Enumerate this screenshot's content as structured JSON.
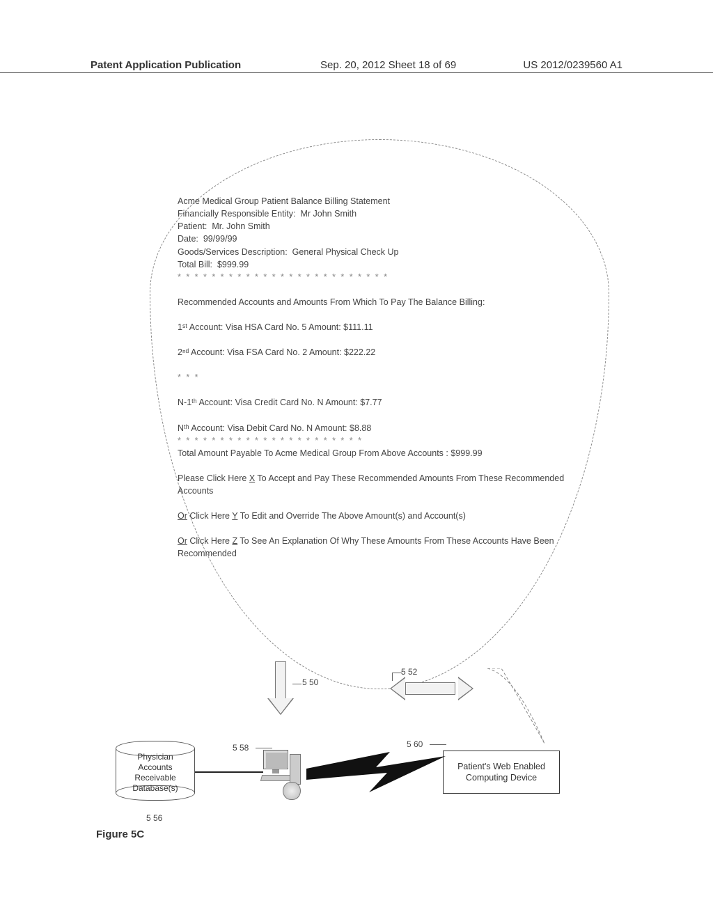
{
  "header": {
    "left": "Patent Application Publication",
    "center": "Sep. 20, 2012  Sheet 18 of 69",
    "right": "US 2012/0239560 A1"
  },
  "statement": {
    "title": "Acme Medical Group Patient Balance Billing Statement",
    "responsible_label": "Financially Responsible Entity:",
    "responsible_value": "Mr John Smith",
    "patient_label": "Patient:",
    "patient_value": "Mr. John Smith",
    "date_label": "Date:",
    "date_value": "99/99/99",
    "goods_label": "Goods/Services Description:",
    "goods_value": "General Physical Check Up",
    "total_label": "Total Bill:",
    "total_value": "$999.99",
    "separator1": "* * * * * * * * * * * * * * * * * * * * * * * * *",
    "rec_heading": "Recommended Accounts and Amounts From Which To Pay The Balance Billing:",
    "acct1": "1ˢᵗ Account:  Visa HSA Card No. 5   Amount: $111.11",
    "acct2": "2ⁿᵈ  Account: Visa FSA Card No. 2 Amount: $222.22",
    "ellipsis": "* * *",
    "acctNm1": "N-1ᵗʰ Account:  Visa Credit Card No. N Amount: $7.77",
    "acctN": "Nᵗʰ  Account:  Visa Debit Card No. N Amount: $8.88",
    "separator2": "* * * * * *  * * * * * * * * * * * * * * * *",
    "total_payable": "Total Amount Payable To Acme Medical Group From Above Accounts : $999.99",
    "accept_prefix": "Please Click Here ",
    "accept_link": "X",
    "accept_suffix": " To Accept and Pay These Recommended Amounts From These Recommended Accounts",
    "edit_prefix_u": "Or",
    "edit_mid": " Click Here ",
    "edit_link": "Y",
    "edit_suffix": " To Edit and Override The Above Amount(s) and Account(s)",
    "explain_prefix_u": "Or",
    "explain_mid": " Click Here ",
    "explain_link": "Z",
    "explain_suffix": " To See An Explanation Of Why These Amounts From These Accounts Have Been  Recommended"
  },
  "refs": {
    "r550": "5 50",
    "r552": "5 52",
    "r556": "5 56",
    "r558": "5 58",
    "r560": "5 60"
  },
  "db": {
    "line1": "Physician",
    "line2": "Accounts",
    "line3": "Receivable",
    "line4": "Database(s)"
  },
  "device": {
    "text": "Patient's Web Enabled Computing Device"
  },
  "figure": "Figure 5C"
}
